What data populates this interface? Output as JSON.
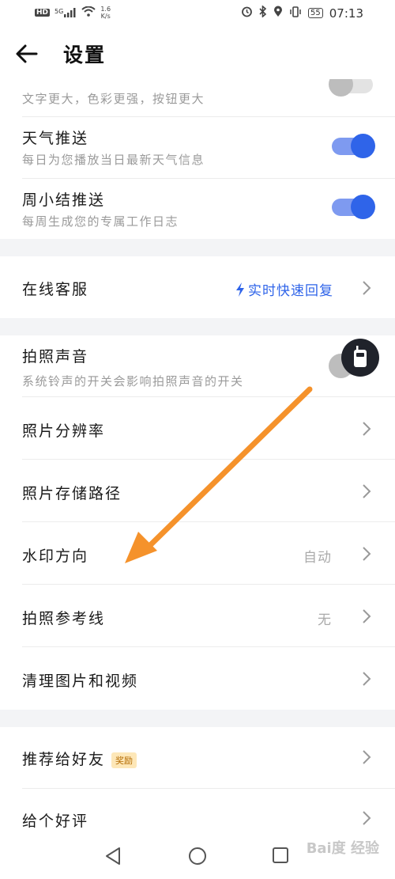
{
  "status_bar": {
    "hd": "HD",
    "signal": "5G",
    "speed_value": "1.6",
    "speed_unit": "K/s",
    "battery": "55",
    "time": "07:13"
  },
  "header": {
    "title": "设置"
  },
  "section1": {
    "items": [
      {
        "sub": "文字更大，色彩更强，按钮更大",
        "toggle_on": false
      },
      {
        "label": "天气推送",
        "sub": "每日为您播放当日最新天气信息",
        "toggle_on": true
      },
      {
        "label": "周小结推送",
        "sub": "每周生成您的专属工作日志",
        "toggle_on": true
      }
    ]
  },
  "section2": {
    "service": {
      "label": "在线客服",
      "value": "实时快速回复"
    }
  },
  "section3": {
    "camera_sound": {
      "label": "拍照声音",
      "sub": "系统铃声的开关会影响拍照声音的开关"
    },
    "resolution": {
      "label": "照片分辨率"
    },
    "storage": {
      "label": "照片存储路径"
    },
    "watermark": {
      "label": "水印方向",
      "value": "自动"
    },
    "guide": {
      "label": "拍照参考线",
      "value": "无"
    },
    "clean": {
      "label": "清理图片和视频"
    }
  },
  "section4": {
    "recommend": {
      "label": "推荐给好友",
      "badge": "奖励"
    },
    "review": {
      "label": "给个好评"
    }
  },
  "watermark_text": "Bai度 经验",
  "colors": {
    "accent": "#2f64e9",
    "arrow": "#f5922b"
  }
}
